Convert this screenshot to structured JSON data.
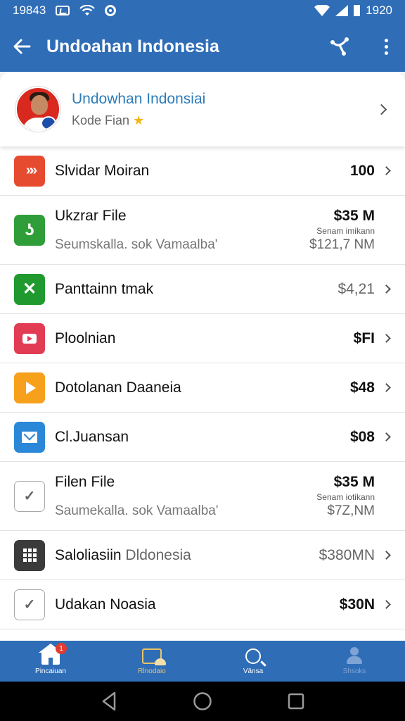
{
  "status_bar": {
    "time": "19843",
    "right_time": "1920"
  },
  "app_bar": {
    "title": "Undoahan Indonesia"
  },
  "profile": {
    "name": "Undowhan Indonsiai",
    "subtitle": "Kode Fian",
    "star": "★"
  },
  "items": [
    {
      "icon": "arrows-icon",
      "title": "Slvidar Moiran",
      "value": "100",
      "sub": "",
      "note": "",
      "value2": ""
    },
    {
      "icon": "scissors-icon",
      "title": "Ukzrar File",
      "value": "$35 M",
      "note": "Senam imikann",
      "sub": "Seumskalla. sok Vamaalba'",
      "value2": "$121,7 NM"
    },
    {
      "icon": "close-icon",
      "title": "Panttainn tmak",
      "value": "$4,21"
    },
    {
      "icon": "video-icon",
      "title": "Ploolnian",
      "value": "$FI"
    },
    {
      "icon": "play-icon",
      "title": "Dotolanan Daaneia",
      "value": "$48"
    },
    {
      "icon": "mail-icon",
      "title": "Cl.Juansan",
      "value": "$08"
    },
    {
      "icon": "check-icon",
      "title": "Filen File",
      "value": "$35 M",
      "note": "Senam iotikann",
      "sub": "Saumekalla. sok Vamaalba'",
      "value2": "$7Z,NM"
    },
    {
      "icon": "grid-icon",
      "title": "Saloliasiin",
      "title2": "Dldonesia",
      "value": "$380MN"
    },
    {
      "icon": "check-icon",
      "title": "Udakan Noasia",
      "value": "$30N"
    }
  ],
  "bottom_nav": [
    {
      "label": "Pincaiuan",
      "badge": "1"
    },
    {
      "label": "Rlnodaio"
    },
    {
      "label": "Vänsa"
    },
    {
      "label": "Shsoks"
    }
  ],
  "colors": {
    "primary": "#2f6db7",
    "accent_link": "#2c7cb8"
  }
}
